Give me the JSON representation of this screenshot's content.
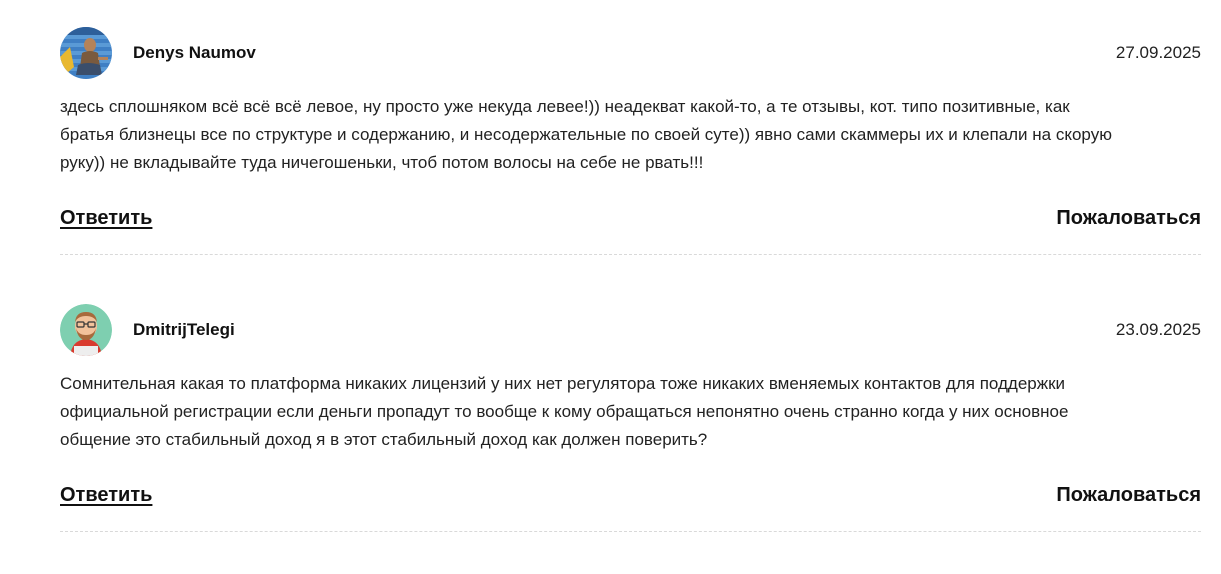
{
  "reviews": [
    {
      "author": "Denys Naumov",
      "date": "27.09.2025",
      "avatar": "photo-avatar",
      "text_lines": [
        "здесь сплошняком всё всё всё левое, ну просто уже некуда левее!)) неадекват какой-то, а те отзывы, кот. типо позитивные, как",
        "братья близнецы все по структуре и содержанию, и несодержательные по своей суте)) явно сами скаммеры их и клепали на скорую",
        "руку)) не вкладывайте туда ничегошеньки, чтоб потом волосы на себе не рвать!!!"
      ],
      "reply_label": "Ответить",
      "report_label": "Пожаловаться"
    },
    {
      "author": "DmitrijTelegi",
      "date": "23.09.2025",
      "avatar": "cartoon-avatar",
      "text_lines": [
        "Сомнительная какая то платформа никаких лицензий у них нет регулятора тоже никаких вменяемых контактов для поддержки",
        "официальной регистрации если деньги пропадут то вообще к кому обращаться непонятно очень странно когда у них основное",
        "общение это стабильный доход я в этот стабильный доход как должен поверить?"
      ],
      "reply_label": "Ответить",
      "report_label": "Пожаловаться"
    }
  ]
}
